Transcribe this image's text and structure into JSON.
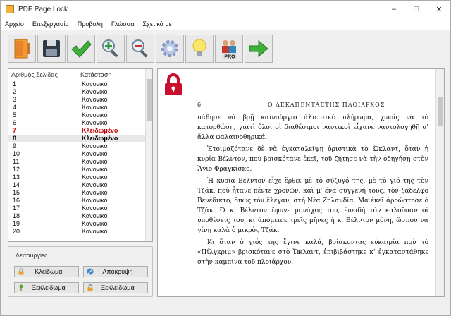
{
  "window": {
    "title": "PDF Page Lock"
  },
  "menu": [
    "Αρχείο",
    "Επεξεργασία",
    "Προβολή",
    "Γλώσσα",
    "Σχετικά με"
  ],
  "toolbar": [
    {
      "name": "open-icon"
    },
    {
      "name": "save-icon"
    },
    {
      "name": "check-icon"
    },
    {
      "name": "zoom-in-icon"
    },
    {
      "name": "zoom-out-icon"
    },
    {
      "name": "settings-gear-icon"
    },
    {
      "name": "lightbulb-icon"
    },
    {
      "name": "pro-users-icon",
      "label": "PRO"
    },
    {
      "name": "next-arrow-icon"
    }
  ],
  "list": {
    "header": {
      "page": "Αριθμός Σελίδας",
      "status": "Κατάσταση"
    },
    "rows": [
      {
        "page": "1",
        "status": "Κανονικό",
        "state": "normal"
      },
      {
        "page": "2",
        "status": "Κανονικό",
        "state": "normal"
      },
      {
        "page": "3",
        "status": "Κανονικό",
        "state": "normal"
      },
      {
        "page": "4",
        "status": "Κανονικό",
        "state": "normal"
      },
      {
        "page": "5",
        "status": "Κανονικό",
        "state": "normal"
      },
      {
        "page": "6",
        "status": "Κανονικό",
        "state": "normal"
      },
      {
        "page": "7",
        "status": "Κλειδωμένο",
        "state": "locked"
      },
      {
        "page": "8",
        "status": "Κλειδωμένο",
        "state": "selected"
      },
      {
        "page": "9",
        "status": "Κανονικό",
        "state": "normal"
      },
      {
        "page": "10",
        "status": "Κανονικό",
        "state": "normal"
      },
      {
        "page": "11",
        "status": "Κανονικό",
        "state": "normal"
      },
      {
        "page": "12",
        "status": "Κανονικό",
        "state": "normal"
      },
      {
        "page": "13",
        "status": "Κανονικό",
        "state": "normal"
      },
      {
        "page": "14",
        "status": "Κανονικό",
        "state": "normal"
      },
      {
        "page": "15",
        "status": "Κανονικό",
        "state": "normal"
      },
      {
        "page": "16",
        "status": "Κανονικό",
        "state": "normal"
      },
      {
        "page": "17",
        "status": "Κανονικό",
        "state": "normal"
      },
      {
        "page": "18",
        "status": "Κανονικό",
        "state": "normal"
      },
      {
        "page": "19",
        "status": "Κανονικό",
        "state": "normal"
      },
      {
        "page": "20",
        "status": "Κανονικό",
        "state": "normal"
      }
    ]
  },
  "operations": {
    "title": "Λειτουργίες",
    "lock": "Κλείδωμα",
    "hide": "Απόκρυψη",
    "unlock1": "Ξεκλείδωμα",
    "unlock2": "Ξεκλείδωμα"
  },
  "page": {
    "number": "6",
    "running_title": "Ο ΔΕΚΑΠΕΝΤΑΕΤΗΣ ΠΛΟΙΑΡΧΟΣ",
    "paragraphs": [
      "πάθησε νὰ βρῇ καινούργιο ἁλιευτικὸ πλήρωμα, χωρὶς νὰ τὸ κατορθώσῃ, γιατὶ ὅλοι οἱ διαθέσιμοι ναυτικοὶ εἶχανε ναυτολογηθῇ σ' ἄλλα φαλαινοθηρικά.",
      "Ἑτοιμαζότανε δὲ νὰ ἐγκαταλείψῃ ὁριστικὰ τὸ Ὤκλαντ, ὅταν ἡ κυρία Βέλντον, ποὺ βρισκότανε ἐκεῖ, τοῦ ζήτησε νὰ τὴν ὁδηγήσῃ στὸν Ἅγιο Φραγκίσκο.",
      "Ἡ κυρία Βέλντον εἶχε ἔρθει μὲ τὸ σύζυγό της, μὲ τὸ γιό της τὸν Τζάκ, ποὺ ἦτανε πέντε χρονῶν, καὶ μ' ἕνα συγγενή τους, τὸν ξάδελφο Βενέδικτο, ὅπως τὸν ἔλεγαν, στὴ Νέα Ζηλανδία. Μὰ ἐκεῖ ἀρρώστησε ὁ Τζάκ. Ὁ κ. Βέλντον ἔφυγε μονάχος του, ἐπειδὴ τὸν καλοῦσαν οἱ ὑποθέσεις του, κι ἀπόμεινε τρεῖς μῆνες ἡ κ. Βέλντον μόνη, ὥσπου νὰ γίνῃ καλὰ ὁ μικρὸς Τζάκ.",
      "Κι ὅταν ὁ γιός της ἔγινε καλά, βρίσκοντας εὐκαιρία ποὺ τὸ «Πίλγκριμ» βρισκότανε στὸ Ὤκλαντ, ἐπιβιβάστηκε κ' ἐγκαταστάθηκε στὴν καμπίνα τοῦ πλοιάρχου."
    ]
  },
  "colors": {
    "lock_red": "#c8102e",
    "locked_text": "#c00000"
  }
}
